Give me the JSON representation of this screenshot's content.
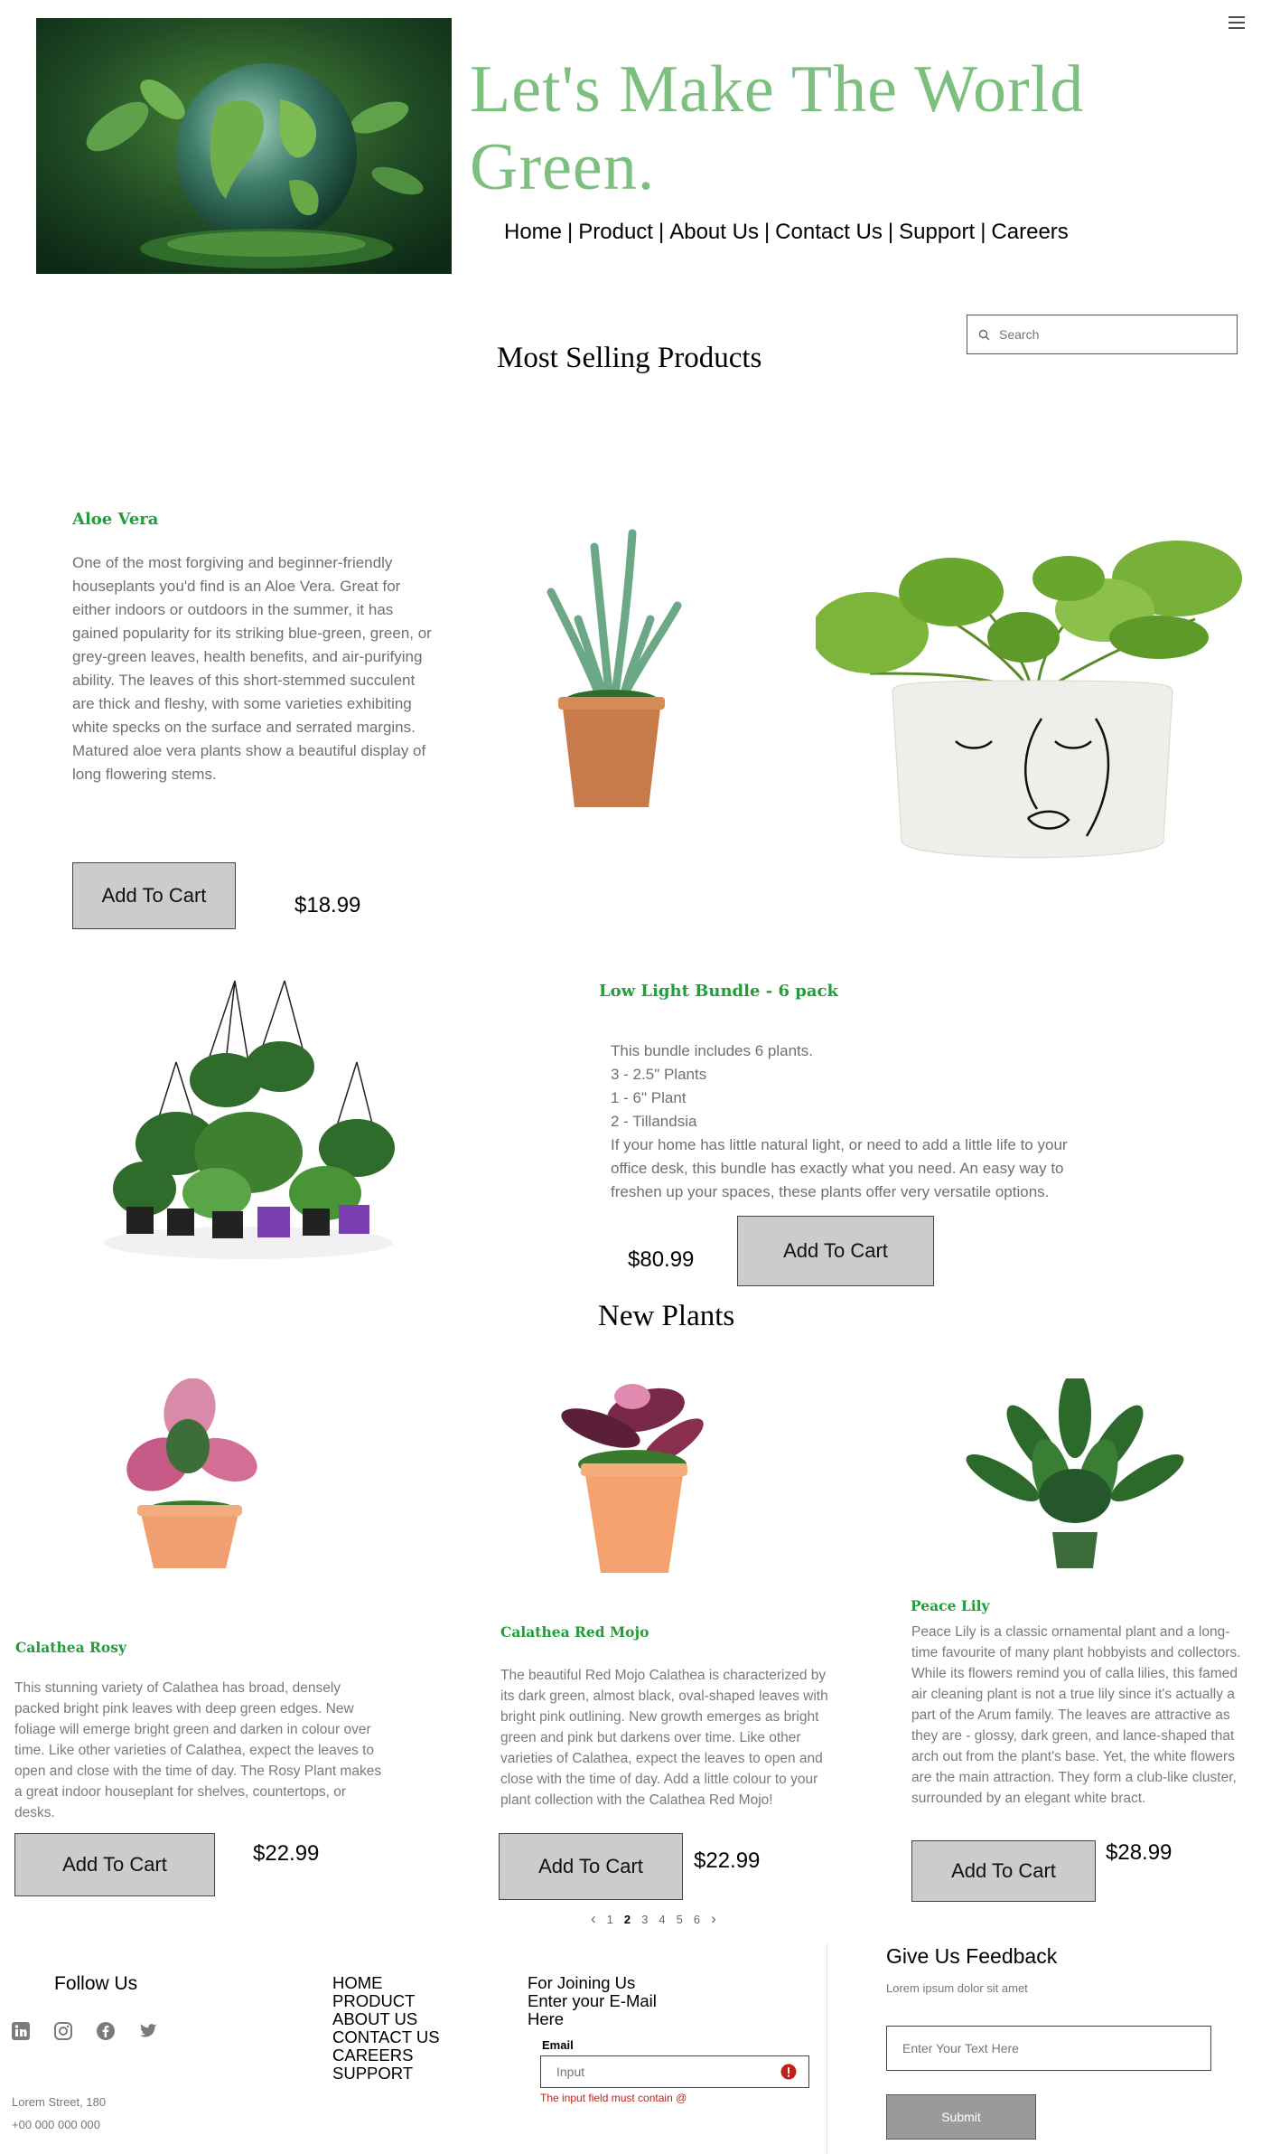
{
  "header": {
    "headline": "Let's Make The World Green.",
    "nav": [
      "Home",
      "Product",
      "About Us",
      "Contact Us",
      "Support",
      "Careers"
    ],
    "search_placeholder": "Search"
  },
  "most_selling": {
    "heading": "Most Selling Products",
    "product1": {
      "title": "Aloe Vera",
      "desc": "One of the most forgiving and beginner-friendly houseplants you'd find is an Aloe Vera. Great for either indoors or outdoors in the summer, it has gained popularity for its striking blue-green, green, or grey-green leaves, health benefits, and air-purifying ability. The leaves of this short-stemmed succulent are thick and fleshy, with some varieties exhibiting white specks on the surface and serrated margins. Matured aloe vera plants show a beautiful display of long flowering stems.",
      "button": "Add To Cart",
      "price": "$18.99"
    },
    "product2": {
      "title": "Low Light Bundle - 6 pack",
      "lines": [
        "This bundle includes 6 plants.",
        "3 - 2.5\" Plants",
        "1 - 6\" Plant",
        "2 - Tillandsia"
      ],
      "desc": "If your home has little natural light, or need to add a little life to your office desk, this bundle has exactly what you need. An easy way to freshen up your spaces, these plants offer very versatile options.",
      "button": "Add To Cart",
      "price": "$80.99"
    }
  },
  "new_plants": {
    "heading": "New Plants",
    "items": [
      {
        "title": "Calathea Rosy",
        "desc": "This stunning variety of Calathea has broad, densely packed bright pink leaves with deep green edges. New foliage will emerge bright green and darken in colour over time. Like other varieties of Calathea, expect the leaves to open and close with the time of day. The Rosy Plant makes a great indoor houseplant for shelves, countertops, or desks.",
        "button": "Add To Cart",
        "price": "$22.99"
      },
      {
        "title": "Calathea Red Mojo",
        "desc": "The beautiful Red Mojo Calathea is characterized by its dark green, almost black, oval-shaped leaves with bright pink outlining. New growth emerges as bright green and pink but darkens over time. Like other varieties of Calathea, expect the leaves to open and close with the time of day. Add a little colour to your plant collection with the Calathea Red Mojo!",
        "button": "Add To Cart",
        "price": "$22.99"
      },
      {
        "title": "Peace Lily",
        "desc": "Peace Lily is a classic ornamental plant and a long-time favourite of many plant hobbyists and collectors. While its flowers remind you of calla lilies, this famed air cleaning plant is not a true lily since it's actually a part of the Arum family. The leaves are attractive as they are - glossy, dark green, and lance-shaped that arch out from the plant's base. Yet, the white flowers are the main attraction. They form a club-like cluster, surrounded by an elegant white bract.",
        "button": "Add To Cart",
        "price": "$28.99"
      }
    ],
    "pagination": {
      "prev": "‹",
      "pages": [
        "1",
        "2",
        "3",
        "4",
        "5",
        "6"
      ],
      "current": "2",
      "next": "›"
    }
  },
  "footer": {
    "follow_us": "Follow Us",
    "address": "Lorem Street, 180",
    "phone": "+00 000 000 000",
    "links": [
      "HOME",
      "PRODUCT",
      "ABOUT US",
      "CONTACT US",
      "CAREERS",
      "SUPPORT"
    ],
    "join_text": [
      "For Joining Us",
      "Enter your E-Mail",
      "Here"
    ],
    "email_label": "Email",
    "email_placeholder": "Input",
    "email_error": "The input field must contain @",
    "feedback_title": "Give Us Feedback",
    "feedback_sub": "Lorem ipsum dolor sit amet",
    "feedback_placeholder": "Enter Your Text Here",
    "submit": "Submit"
  },
  "colors": {
    "headline": "#7dbf7f",
    "product_title": "#1f9e3a",
    "error": "#c0201c"
  }
}
